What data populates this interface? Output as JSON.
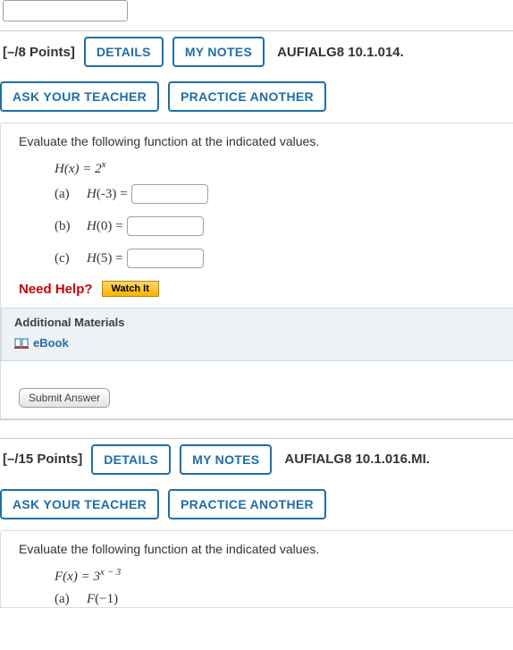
{
  "buttons": {
    "details": "DETAILS",
    "mynotes": "MY NOTES",
    "askteacher": "ASK YOUR TEACHER",
    "practice": "PRACTICE ANOTHER",
    "watchit": "Watch It",
    "submit": "Submit Answer"
  },
  "labels": {
    "needhelp": "Need Help?",
    "additional": "Additional Materials",
    "ebook": "eBook"
  },
  "problems": [
    {
      "points": "[–/8 Points]",
      "reference": "AUFIALG8 10.1.014.",
      "prompt": "Evaluate the following function at the indicated values.",
      "fn_lhs": "H(x) = ",
      "fn_base": "2",
      "fn_exp": "x",
      "parts": [
        {
          "label": "(a)",
          "expr_fn": "H",
          "expr_arg": "(-3)",
          "eq": " =",
          "input": true
        },
        {
          "label": "(b)",
          "expr_fn": "H",
          "expr_arg": "(0)",
          "eq": " =",
          "input": true
        },
        {
          "label": "(c)",
          "expr_fn": "H",
          "expr_arg": "(5)",
          "eq": " =",
          "input": true
        }
      ]
    },
    {
      "points": "[–/15 Points]",
      "reference": "AUFIALG8 10.1.016.MI.",
      "prompt": "Evaluate the following function at the indicated values.",
      "fn_lhs": "F(x) = ",
      "fn_base": "3",
      "fn_exp": "x − 3",
      "parts": [
        {
          "label": "(a)",
          "expr_fn": "F",
          "expr_arg": "(−1)",
          "eq": "",
          "input": false
        }
      ]
    }
  ]
}
